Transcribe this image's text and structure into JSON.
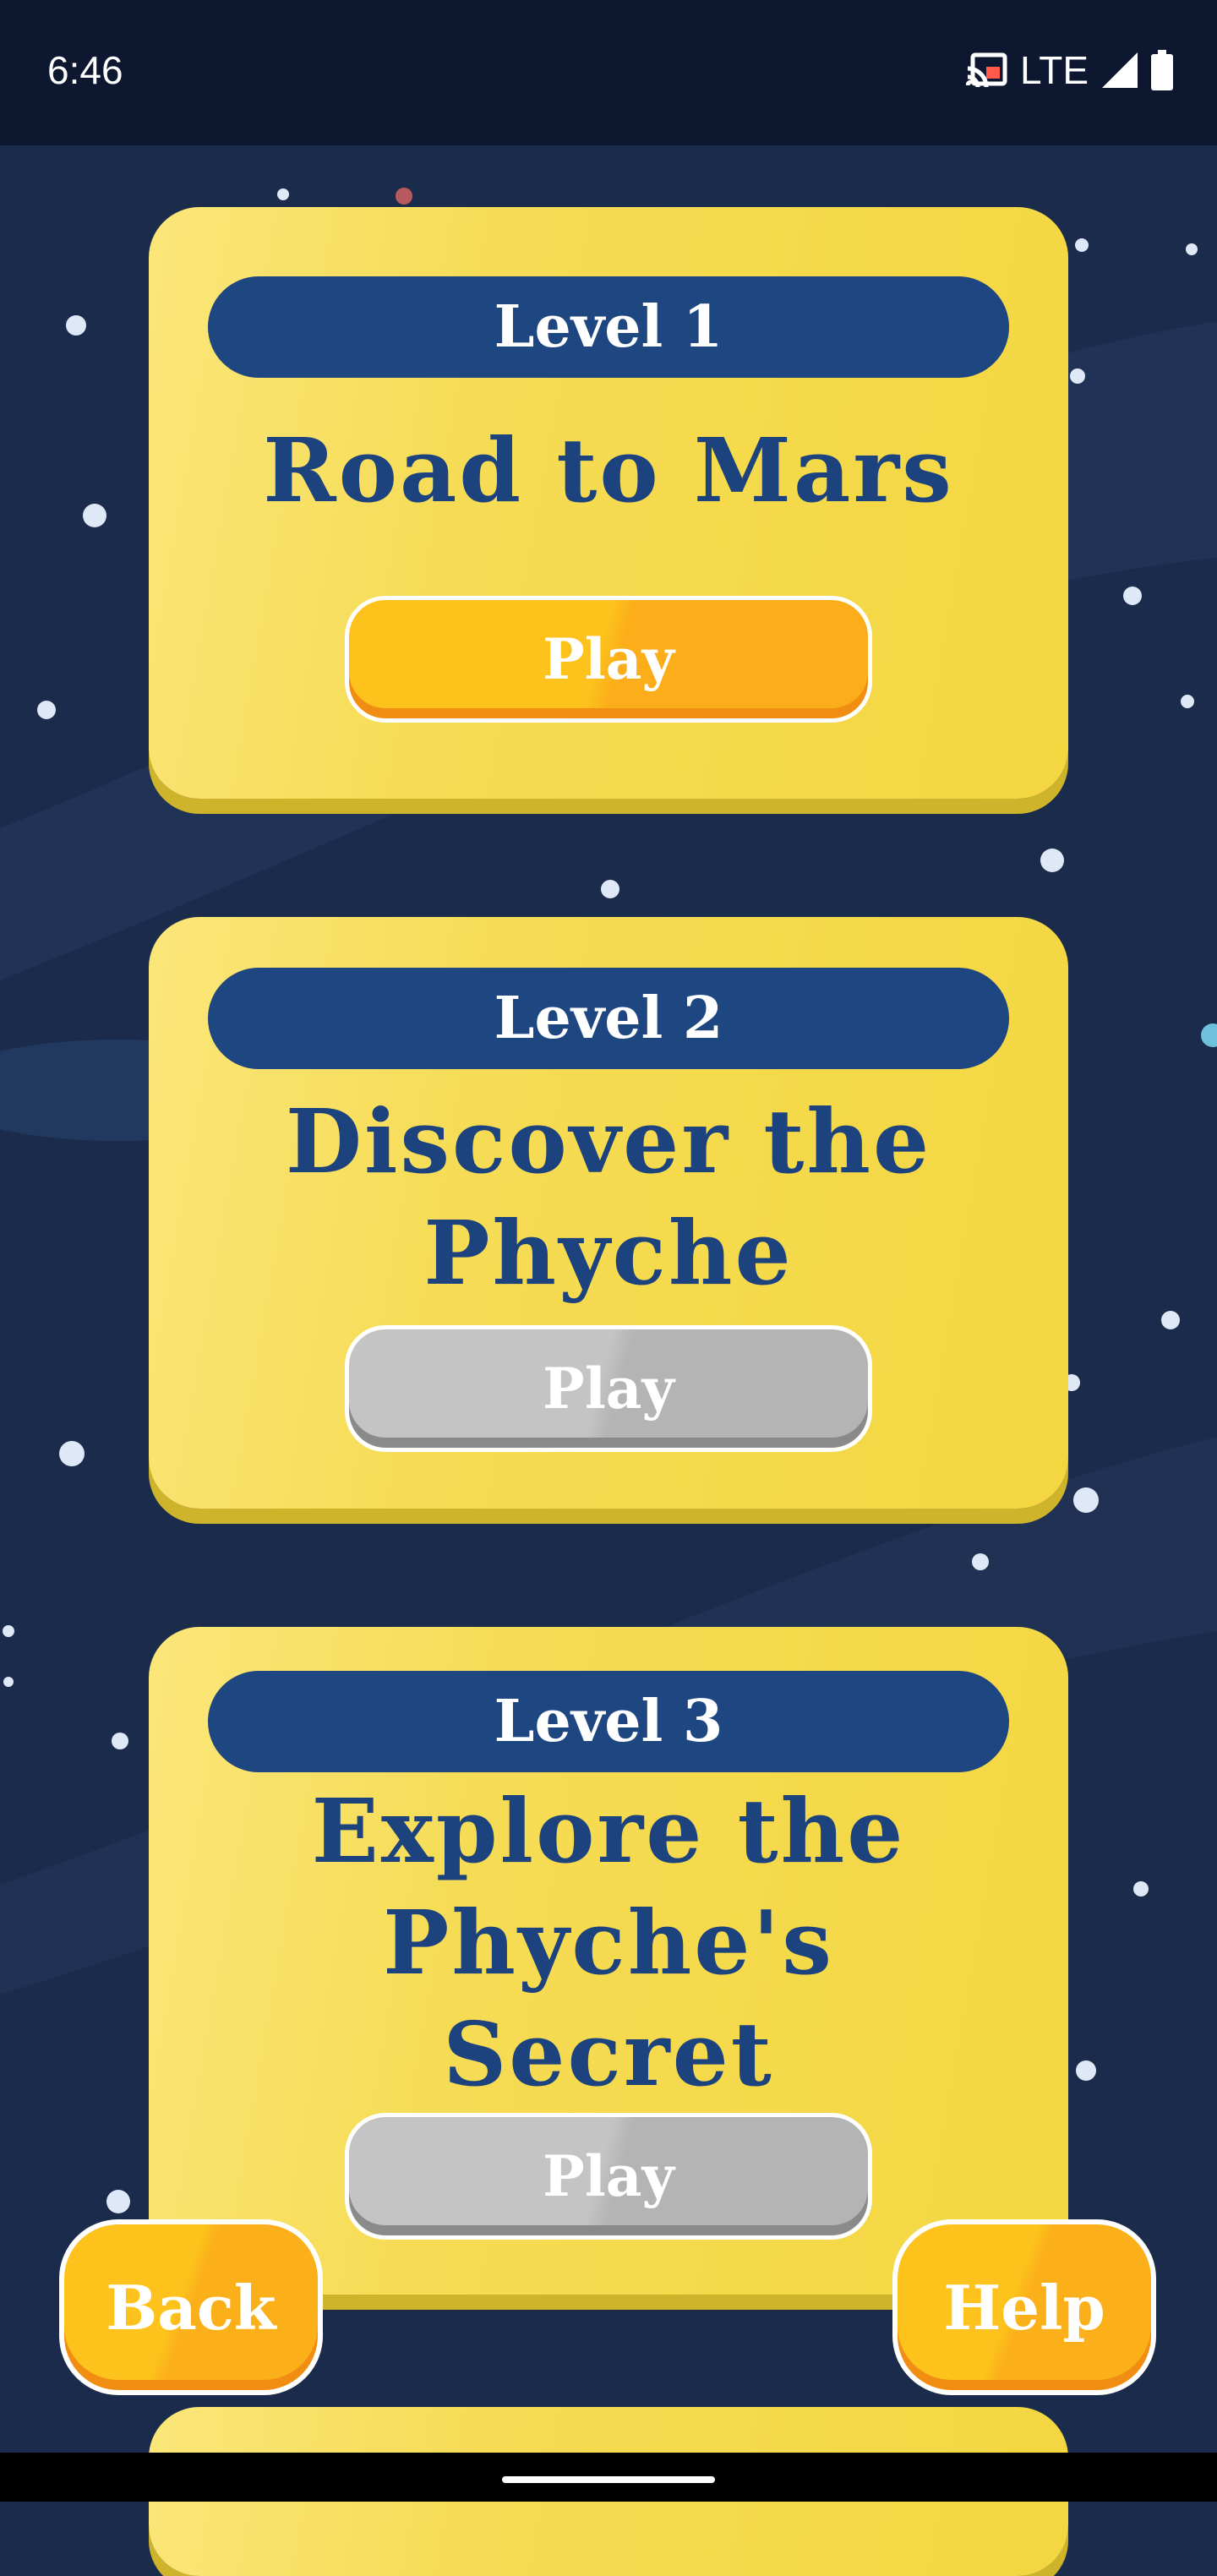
{
  "status_bar": {
    "time": "6:46",
    "network": "LTE",
    "icons": [
      "cast-icon",
      "signal-icon",
      "battery-icon"
    ]
  },
  "levels": [
    {
      "label": "Level 1",
      "title": [
        "Road to Mars"
      ],
      "button": "Play",
      "state": "active"
    },
    {
      "label": "Level 2",
      "title": [
        "Discover the",
        "Phyche"
      ],
      "button": "Play",
      "state": "locked"
    },
    {
      "label": "Level 3",
      "title": [
        "Explore the",
        "Phyche's",
        "Secret"
      ],
      "button": "Play",
      "state": "locked"
    }
  ],
  "controls": {
    "back": "Back",
    "help": "Help"
  },
  "colors": {
    "card": "#f6dc55",
    "pill": "#1e4681",
    "title": "#1d437f",
    "play_active": "#fdc21c",
    "play_locked": "#c4c4c4",
    "background": "#1c2c4c"
  }
}
